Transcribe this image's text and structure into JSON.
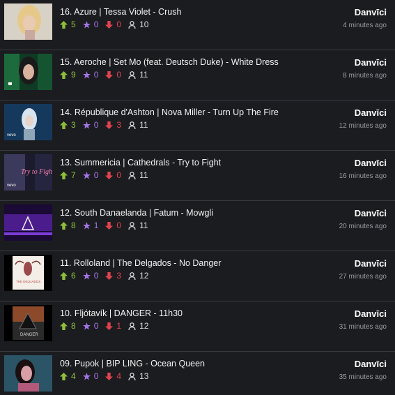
{
  "entries": [
    {
      "title": "16. Azure | Tessa Violet - Crush",
      "up": "5",
      "star": "0",
      "down": "0",
      "views": "10",
      "user": "Danvīci",
      "time": "4 minutes ago",
      "thumb": "thumb-16"
    },
    {
      "title": "15. Aeroche | Set Mo (feat. Deutsch Duke) - White Dress",
      "up": "9",
      "star": "0",
      "down": "0",
      "views": "11",
      "user": "Danvīci",
      "time": "8 minutes ago",
      "thumb": "thumb-15"
    },
    {
      "title": "14. République d'Ashton | Nova Miller - Turn Up The Fire",
      "up": "3",
      "star": "0",
      "down": "3",
      "views": "11",
      "user": "Danvīci",
      "time": "12 minutes ago",
      "thumb": "thumb-14"
    },
    {
      "title": "13. Summericia | Cathedrals - Try to Fight",
      "up": "7",
      "star": "0",
      "down": "0",
      "views": "11",
      "user": "Danvīci",
      "time": "16 minutes ago",
      "thumb": "thumb-13"
    },
    {
      "title": "12. South Danaelanda | Fatum - Mowgli",
      "up": "8",
      "star": "1",
      "down": "0",
      "views": "11",
      "user": "Danvīci",
      "time": "20 minutes ago",
      "thumb": "thumb-12"
    },
    {
      "title": "11. Rolloland | The Delgados - No Danger",
      "up": "6",
      "star": "0",
      "down": "3",
      "views": "12",
      "user": "Danvīci",
      "time": "27 minutes ago",
      "thumb": "thumb-11"
    },
    {
      "title": "10. Fljótavík | DANGER - 11h30",
      "up": "8",
      "star": "0",
      "down": "1",
      "views": "12",
      "user": "Danvīci",
      "time": "31 minutes ago",
      "thumb": "thumb-10"
    },
    {
      "title": "09. Pupok | BIP LING - Ocean Queen",
      "up": "4",
      "star": "0",
      "down": "4",
      "views": "13",
      "user": "Danvīci",
      "time": "35 minutes ago",
      "thumb": "thumb-09"
    }
  ],
  "icons": {
    "up": "upvote-arrow-icon",
    "star": "star-icon",
    "down": "downvote-arrow-icon",
    "views": "user-icon"
  },
  "thumb_text": {
    "vevo": "vevo",
    "try_to_fight": "Try to Fight",
    "delgados": "THE DELGADOS",
    "danger": "DANGER"
  },
  "colors": {
    "background": "#1b1c20",
    "divider": "#3a3b40",
    "upvote": "#8fbf3a",
    "star": "#a476e8",
    "downvote": "#e0434e",
    "timestamp": "#9a9ba0"
  }
}
